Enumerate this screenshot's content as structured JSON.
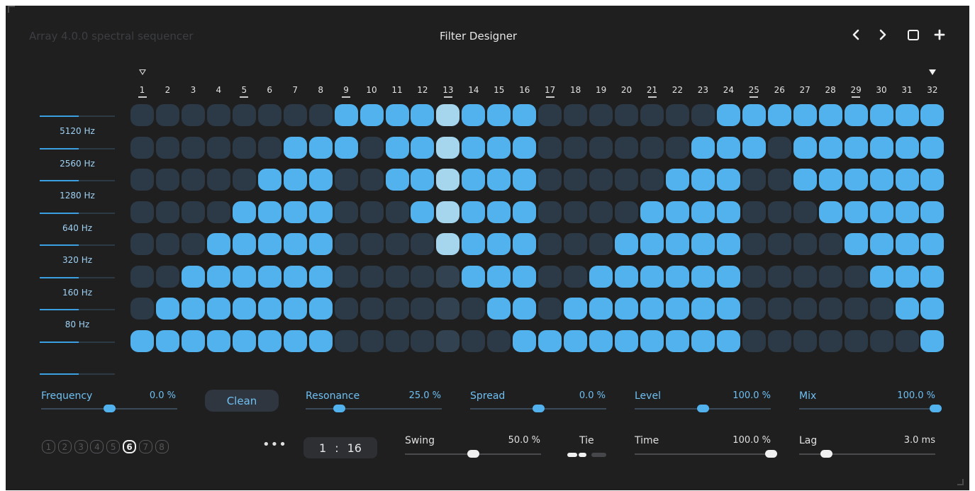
{
  "header": {
    "app_title": "Array 4.0.0 spectral sequencer",
    "page_title": "Filter Designer",
    "nav": [
      {
        "name": "prev-icon",
        "glyph": "‹"
      },
      {
        "name": "next-icon",
        "glyph": "›"
      },
      {
        "name": "window-icon",
        "glyph": ""
      },
      {
        "name": "add-icon",
        "glyph": "+"
      }
    ]
  },
  "steps": {
    "labels": [
      "1",
      "2",
      "3",
      "4",
      "5",
      "6",
      "7",
      "8",
      "9",
      "10",
      "11",
      "12",
      "13",
      "14",
      "15",
      "16",
      "17",
      "18",
      "19",
      "20",
      "21",
      "22",
      "23",
      "24",
      "25",
      "26",
      "27",
      "28",
      "29",
      "30",
      "31",
      "32"
    ],
    "underlined": [
      1,
      5,
      9,
      13,
      17,
      21,
      25,
      29
    ],
    "current_step": 13,
    "loop_start": 1,
    "loop_end": 32
  },
  "bands": {
    "labels": [
      "5120 Hz",
      "2560 Hz",
      "1280 Hz",
      "640 Hz",
      "320 Hz",
      "160 Hz",
      "80 Hz"
    ]
  },
  "grid": {
    "rows": [
      "00000000111111110000000111111111",
      "00000011101111110000001110111111",
      "00000111001111110000011100111111",
      "00001111000111110000111100011111",
      "00011111000011110001111100001111",
      "00111111000001110011111100000111",
      "01111111000000110111111100000011",
      "11111111000000011111111100000001"
    ]
  },
  "controls": {
    "frequency": {
      "label": "Frequency",
      "value": "0.0 %",
      "level": 0.5
    },
    "clean": {
      "label": "Clean"
    },
    "resonance": {
      "label": "Resonance",
      "value": "25.0 %",
      "level": 0.25
    },
    "spread": {
      "label": "Spread",
      "value": "0.0 %",
      "level": 0.5
    },
    "level": {
      "label": "Level",
      "value": "100.0 %",
      "level": 0.5
    },
    "mix": {
      "label": "Mix",
      "value": "100.0 %",
      "level": 1.0
    },
    "swing": {
      "label": "Swing",
      "value": "50.0 %",
      "level": 0.5
    },
    "tie": {
      "label": "Tie"
    },
    "time": {
      "label": "Time",
      "value": "100.0 %",
      "level": 1.0
    },
    "lag": {
      "label": "Lag",
      "value": "3.0 ms",
      "level": 0.2
    }
  },
  "patterns": {
    "items": [
      "1",
      "2",
      "3",
      "4",
      "5",
      "6",
      "7",
      "8"
    ],
    "active": 6,
    "more": "•••"
  },
  "ratio": {
    "left": "1",
    "sep": ":",
    "right": "16"
  },
  "colors": {
    "background": "#1f1f20",
    "accent": "#52b2ee",
    "cell_off": "#2c3946",
    "cell_highlight": "#a6d6ee",
    "label_blue": "#6fc0f2"
  }
}
